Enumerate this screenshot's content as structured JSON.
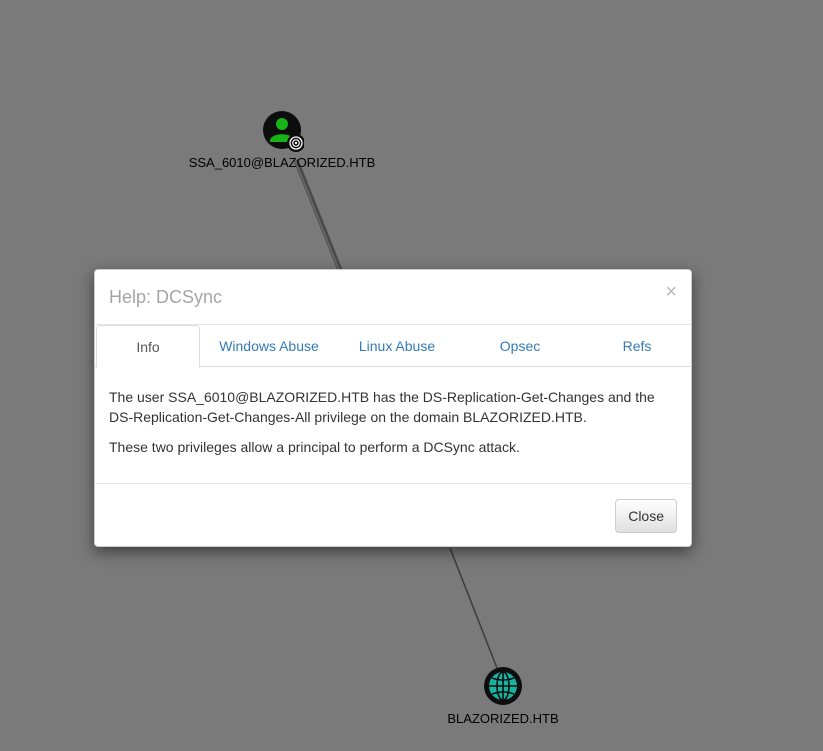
{
  "graph": {
    "nodes": [
      {
        "id": "user",
        "label": "SSA_6010@BLAZORIZED.HTB",
        "type": "user",
        "icon": "user-icon",
        "color": "#17b317"
      },
      {
        "id": "domain",
        "label": "BLAZORIZED.HTB",
        "type": "domain",
        "icon": "globe-icon",
        "color": "#17b3a0"
      }
    ]
  },
  "modal": {
    "title": "Help: DCSync",
    "close_x": "×",
    "tabs": [
      {
        "label": "Info",
        "active": true
      },
      {
        "label": "Windows Abuse",
        "active": false
      },
      {
        "label": "Linux Abuse",
        "active": false
      },
      {
        "label": "Opsec",
        "active": false
      },
      {
        "label": "Refs",
        "active": false
      }
    ],
    "body": {
      "paragraph1": "The user SSA_6010@BLAZORIZED.HTB has the DS-Replication-Get-Changes and the DS-Replication-Get-Changes-All privilege on the domain BLAZORIZED.HTB.",
      "paragraph2": "These two privileges allow a principal to perform a DCSync attack."
    },
    "close_button": "Close"
  },
  "colors": {
    "canvas_background": "#7a7a7a",
    "user_node": "#17b317",
    "domain_node": "#17b3a0",
    "link": "#337ab7"
  }
}
